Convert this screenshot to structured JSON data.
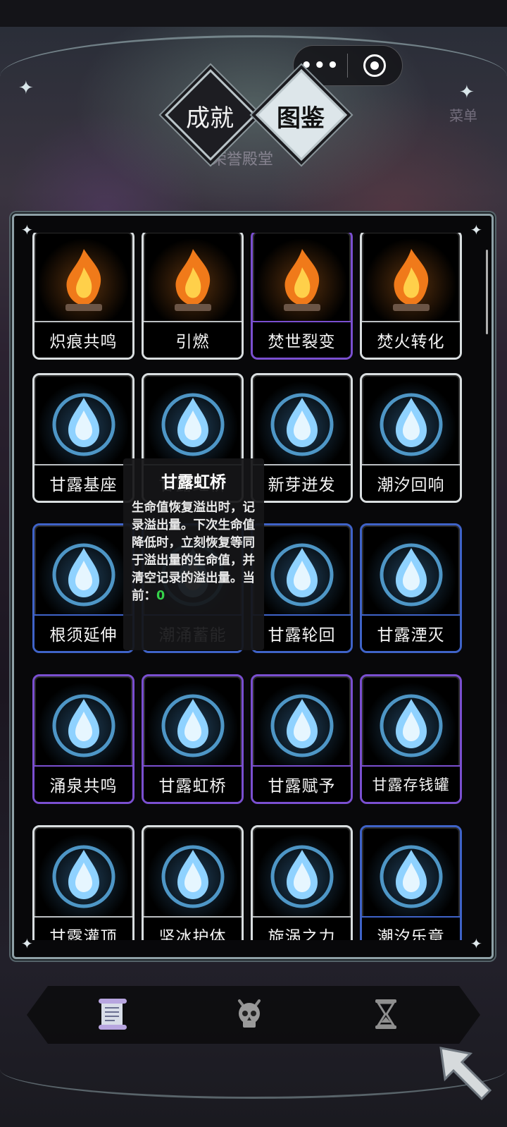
{
  "header": {
    "tabs": [
      {
        "label": "成就",
        "active": false
      },
      {
        "label": "图鉴",
        "active": true
      }
    ],
    "background_title": "荣誉殿堂",
    "background_menu": "菜单"
  },
  "capsule": {
    "more_glyph": "•••"
  },
  "cards": [
    {
      "label": "炽痕共鸣",
      "icon": "flame-altar-icon",
      "border": "white",
      "theme": "fire"
    },
    {
      "label": "引燃",
      "icon": "flame-pillar-icon",
      "border": "white",
      "theme": "fire"
    },
    {
      "label": "焚世裂变",
      "icon": "fire-orbs-ring-icon",
      "border": "purple",
      "theme": "fire"
    },
    {
      "label": "焚火转化",
      "icon": "flame-spirits-icon",
      "border": "white",
      "theme": "fire"
    },
    {
      "label": "甘露基座",
      "icon": "leaf-droplet-icon",
      "border": "white",
      "theme": "water"
    },
    {
      "label": "甘露虹桥",
      "icon": "crystal-amulet-icon",
      "border": "white",
      "theme": "water"
    },
    {
      "label": "新芽迸发",
      "icon": "phoenix-icon",
      "border": "white",
      "theme": "water"
    },
    {
      "label": "潮汐回响",
      "icon": "heart-hands-icon",
      "border": "white",
      "theme": "water"
    },
    {
      "label": "根须延伸",
      "icon": "triple-drops-icon",
      "border": "blue",
      "theme": "water"
    },
    {
      "label": "潮涌蓄能",
      "icon": "water-circle-icon",
      "border": "blue",
      "theme": "water"
    },
    {
      "label": "甘露轮回",
      "icon": "blood-vial-icon",
      "border": "blue",
      "theme": "water"
    },
    {
      "label": "甘露湮灭",
      "icon": "potion-bottle-icon",
      "border": "blue",
      "theme": "water"
    },
    {
      "label": "涌泉共鸣",
      "icon": "water-sword-icon",
      "border": "purple",
      "theme": "water"
    },
    {
      "label": "甘露虹桥",
      "icon": "coin-jar-icon",
      "border": "purple",
      "theme": "water"
    },
    {
      "label": "甘露赋予",
      "icon": "vortex-shield-icon",
      "border": "purple",
      "theme": "water"
    },
    {
      "label": "甘露存钱罐",
      "icon": "heart-drop-icon",
      "border": "purple",
      "theme": "water"
    },
    {
      "label": "甘露灌顶",
      "icon": "drop-lotus-icon",
      "border": "white",
      "theme": "water"
    },
    {
      "label": "坚冰护体",
      "icon": "ice-helmet-icon",
      "border": "white",
      "theme": "water"
    },
    {
      "label": "旋涡之力",
      "icon": "whirlpool-icon",
      "border": "white",
      "theme": "water"
    },
    {
      "label": "潮汐乐章",
      "icon": "music-wreath-icon",
      "border": "blue",
      "theme": "water"
    }
  ],
  "tooltip": {
    "title": "甘露虹桥",
    "body": "生命值恢复溢出时，记录溢出量。下次生命值降低时，立刻恢复等同于溢出量的生命值，并清空记录的溢出量。当前：",
    "current_value": "0"
  },
  "bottom_nav": [
    {
      "icon": "scroll-icon",
      "active": true
    },
    {
      "icon": "skull-icon",
      "active": false
    },
    {
      "icon": "hourglass-icon",
      "active": false
    }
  ],
  "colors": {
    "frame": "#8ea0a6",
    "card_white": "#d9dee0",
    "card_purple": "#7a4fd0",
    "card_blue": "#3f63c8",
    "tooltip_value": "#35d24a"
  }
}
